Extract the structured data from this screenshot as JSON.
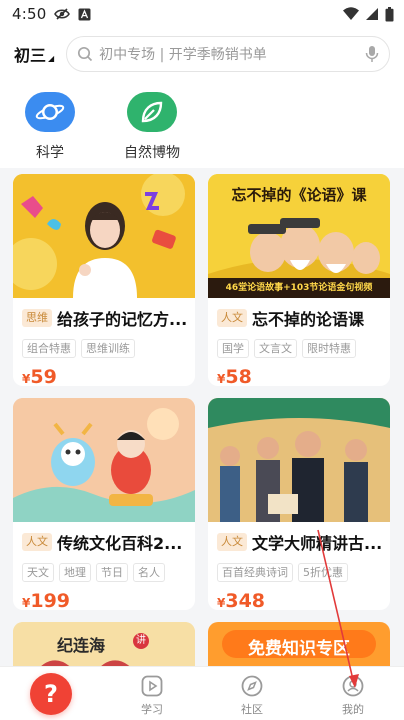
{
  "status_bar": {
    "time": "4:50",
    "icons": [
      "eye-slash-icon",
      "a-badge-icon",
      "wifi-icon",
      "signal-icon",
      "battery-icon"
    ]
  },
  "header": {
    "grade": "初三",
    "search_placeholder": "初中专场 | 开学季畅销书单",
    "icons": [
      "search-icon",
      "microphone-icon"
    ]
  },
  "categories": [
    {
      "label": "科学",
      "icon": "planet-icon",
      "color": "#3b8cf0"
    },
    {
      "label": "自然博物",
      "icon": "leaf-icon",
      "color": "#2fb36d"
    }
  ],
  "courses": [
    {
      "badge": "思维",
      "title": "给孩子的记忆方...",
      "tags": [
        "组合特惠",
        "思维训练"
      ],
      "currency": "¥",
      "price": "59",
      "thumb_color": "#f3c02d"
    },
    {
      "badge": "人文",
      "title": "忘不掉的论语课",
      "tags": [
        "国学",
        "文言文",
        "限时特惠"
      ],
      "currency": "¥",
      "price": "58",
      "thumb_color": "#f6d13a",
      "thumb_title": "忘不掉的《论语》课",
      "thumb_caption": "46堂论语故事+103节论语金句视频"
    },
    {
      "badge": "人文",
      "title": "传统文化百科2...",
      "tags": [
        "天文",
        "地理",
        "节日",
        "名人"
      ],
      "currency": "¥",
      "price": "199",
      "thumb_color": "#f6c9a4"
    },
    {
      "badge": "人文",
      "title": "文学大师精讲古...",
      "tags": [
        "百首经典诗词",
        "5折优惠"
      ],
      "currency": "¥",
      "price": "348",
      "thumb_color": "#e6c07a"
    },
    {
      "thumb_color": "#f7dfa5",
      "thumb_title": "纪连海",
      "thumb_badge": "讲"
    },
    {
      "thumb_color": "#ff9d2e",
      "thumb_title": "免费知识专区"
    }
  ],
  "bottom_nav": {
    "items": [
      {
        "label": "",
        "icon": "question-mark-icon"
      },
      {
        "label": "学习",
        "icon": "play-square-icon"
      },
      {
        "label": "社区",
        "icon": "compass-icon"
      },
      {
        "label": "我的",
        "icon": "user-icon"
      }
    ],
    "accent": "#f04235"
  },
  "colors": {
    "price": "#f05a28",
    "badge_text": "#c98a3a",
    "badge_bg": "#fbe9d6",
    "annotation_arrow": "#e23a3a"
  }
}
